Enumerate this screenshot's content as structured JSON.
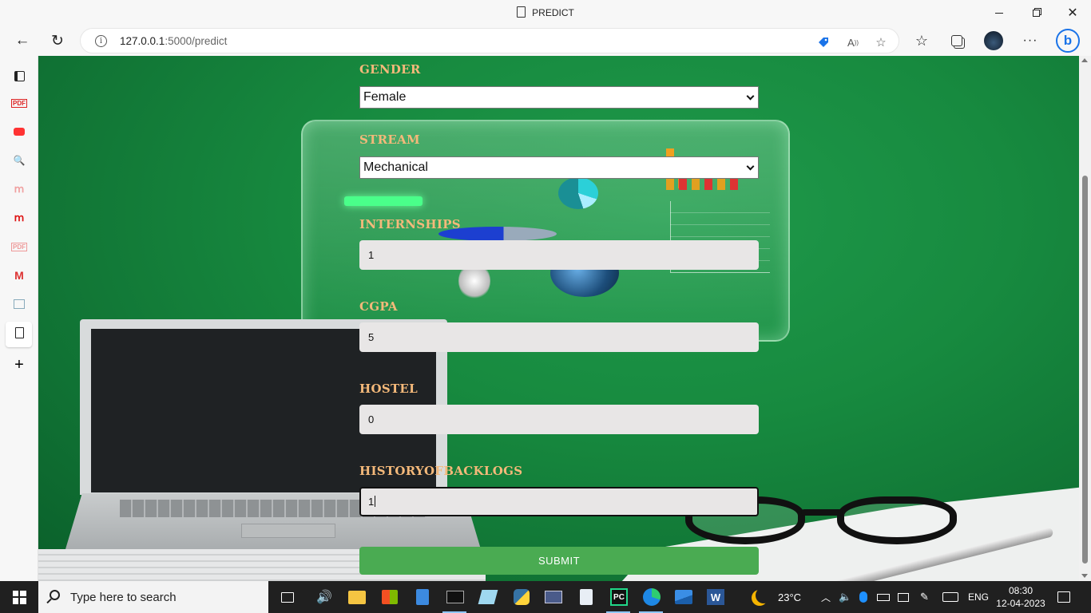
{
  "window": {
    "title": "PREDICT"
  },
  "address_bar": {
    "url_host": "127.0.0.1",
    "url_path": ":5000/predict"
  },
  "form": {
    "gender": {
      "label": "GENDER",
      "value": "Female"
    },
    "stream": {
      "label": "STREAM",
      "value": "Mechanical"
    },
    "internships": {
      "label": "INTERNSHIPS",
      "value": "1"
    },
    "cgpa": {
      "label": "CGPA",
      "value": "5"
    },
    "hostel": {
      "label": "HOSTEL",
      "value": "0"
    },
    "backlogs": {
      "label": "HISTORYOFBACKLOGS",
      "value": "1"
    },
    "submit_label": "SUBMIT"
  },
  "taskbar": {
    "search_placeholder": "Type here to search",
    "weather": "23°C",
    "language": "ENG",
    "time": "08:30",
    "date": "12-04-2023"
  },
  "colors": {
    "label": "#f4b97a",
    "submit": "#4aab52",
    "page_bg": "#178a3f"
  }
}
